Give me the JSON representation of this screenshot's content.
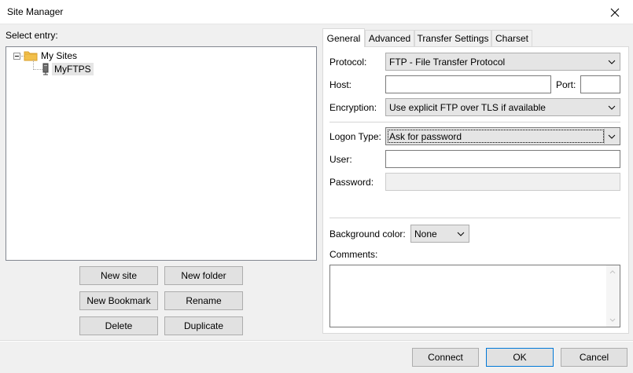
{
  "window": {
    "title": "Site Manager"
  },
  "left": {
    "select_entry_label": "Select entry:",
    "tree": {
      "root_label": "My Sites",
      "children": [
        {
          "label": "MyFTPS",
          "selected": true
        }
      ]
    },
    "buttons": {
      "new_site": "New site",
      "new_folder": "New folder",
      "new_bookmark": "New Bookmark",
      "rename": "Rename",
      "delete": "Delete",
      "duplicate": "Duplicate"
    }
  },
  "tabs": [
    "General",
    "Advanced",
    "Transfer Settings",
    "Charset"
  ],
  "active_tab": "General",
  "general": {
    "protocol_label": "Protocol:",
    "protocol_value": "FTP - File Transfer Protocol",
    "host_label": "Host:",
    "host_value": "",
    "port_label": "Port:",
    "port_value": "",
    "encryption_label": "Encryption:",
    "encryption_value": "Use explicit FTP over TLS if available",
    "logon_type_label": "Logon Type:",
    "logon_type_value": "Ask for password",
    "user_label": "User:",
    "user_value": "",
    "password_label": "Password:",
    "password_value": "",
    "background_color_label": "Background color:",
    "background_color_value": "None",
    "comments_label": "Comments:",
    "comments_value": ""
  },
  "footer": {
    "connect": "Connect",
    "ok": "OK",
    "cancel": "Cancel"
  },
  "icons": {
    "close": "close-icon",
    "folder": "folder-icon",
    "server": "server-icon",
    "dropdown": "chevron-down-icon"
  },
  "colors": {
    "folder": "#f2c04b",
    "selection": "#e5e5e5",
    "button_face": "#e1e1e1"
  }
}
